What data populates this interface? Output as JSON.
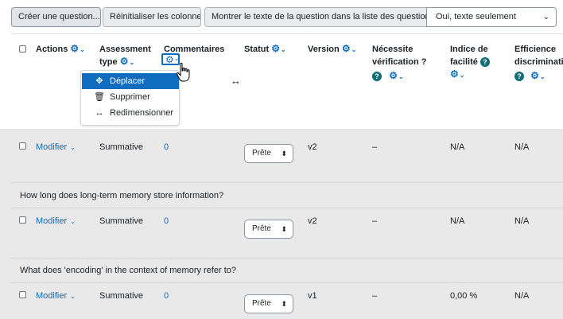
{
  "toolbar": {
    "create_label": "Créer une question...",
    "reset_label": "Réinitialiser les colonnes",
    "show_text_label": "Montrer le texte de la question dans la liste des questions ?",
    "show_text_value": "Oui, texte seulement"
  },
  "columns": [
    {
      "label": "Actions"
    },
    {
      "label_line1": "Assessment",
      "label_line2": "type"
    },
    {
      "label": "Commentaires"
    },
    {
      "label": "Statut"
    },
    {
      "label": "Version"
    },
    {
      "label_line1": "Nécessite",
      "label_line2": "vérification ?"
    },
    {
      "label_line1": "Indice de",
      "label_line2": "facilité"
    },
    {
      "label_line1": "Efficience",
      "label_line2": "discriminativ"
    }
  ],
  "column_menu": {
    "items": [
      {
        "label": "Déplacer",
        "icon": "move-icon"
      },
      {
        "label": "Supprimer",
        "icon": "trash-icon"
      },
      {
        "label": "Redimensionner",
        "icon": "resize-icon"
      }
    ]
  },
  "rows": [
    {
      "edit": "Modifier",
      "assessment": "Summative",
      "comments": "0",
      "status": "Prête",
      "version": "v2",
      "needs_check": "–",
      "facility": "N/A",
      "discrimination": "N/A",
      "question_text": "How long does long-term memory store information?"
    },
    {
      "edit": "Modifier",
      "assessment": "Summative",
      "comments": "0",
      "status": "Prête",
      "version": "v2",
      "needs_check": "–",
      "facility": "N/A",
      "discrimination": "N/A",
      "question_text": "What does 'encoding' in the context of memory refer to?"
    },
    {
      "edit": "Modifier",
      "assessment": "Summative",
      "comments": "0",
      "status": "Prête",
      "version": "v1",
      "needs_check": "–",
      "facility": "0,00 %",
      "discrimination": "N/A"
    }
  ],
  "icons": {
    "settings": "gear-icon",
    "help": "question-help-icon",
    "dropdown": "chevron-down-icon"
  },
  "colors": {
    "link": "#0f6cbf",
    "help_badge": "#0f6e74",
    "active_menu": "#0f6cbf"
  }
}
